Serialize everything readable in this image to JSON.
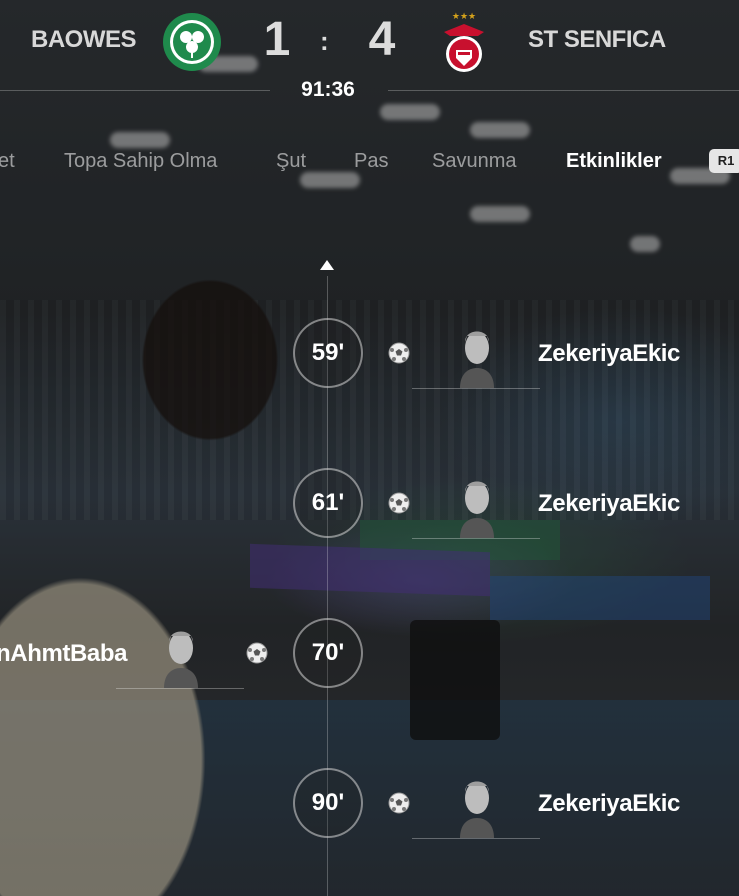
{
  "match": {
    "home_team": "BAOWES",
    "away_team": "ST SENFICA",
    "home_score": "1",
    "separator": ":",
    "away_score": "4",
    "time": "91:36",
    "home_crest_icon": "clover-club-crest-icon",
    "away_crest_icon": "eagle-club-crest-icon"
  },
  "tabs": [
    {
      "label": "et"
    },
    {
      "label": "Topa Sahip Olma"
    },
    {
      "label": "Şut"
    },
    {
      "label": "Pas"
    },
    {
      "label": "Savunma"
    },
    {
      "label": "Etkinlikler",
      "active": true
    }
  ],
  "tab_hint": "R1",
  "events": [
    {
      "minute": "59'",
      "player": "ZekeriyaEkic",
      "side": "away",
      "icon": "soccer-ball-icon"
    },
    {
      "minute": "61'",
      "player": "ZekeriyaEkic",
      "side": "away",
      "icon": "soccer-ball-icon"
    },
    {
      "minute": "70'",
      "player": "nAhmtBaba",
      "side": "home",
      "icon": "soccer-ball-icon"
    },
    {
      "minute": "90'",
      "player": "ZekeriyaEkic",
      "side": "away",
      "icon": "soccer-ball-icon"
    }
  ],
  "colors": {
    "accent": "#ffffff",
    "tab_inactive": "#a0a0a0",
    "home_crest": "#1f8a4c",
    "away_crest": "#c8102e"
  }
}
